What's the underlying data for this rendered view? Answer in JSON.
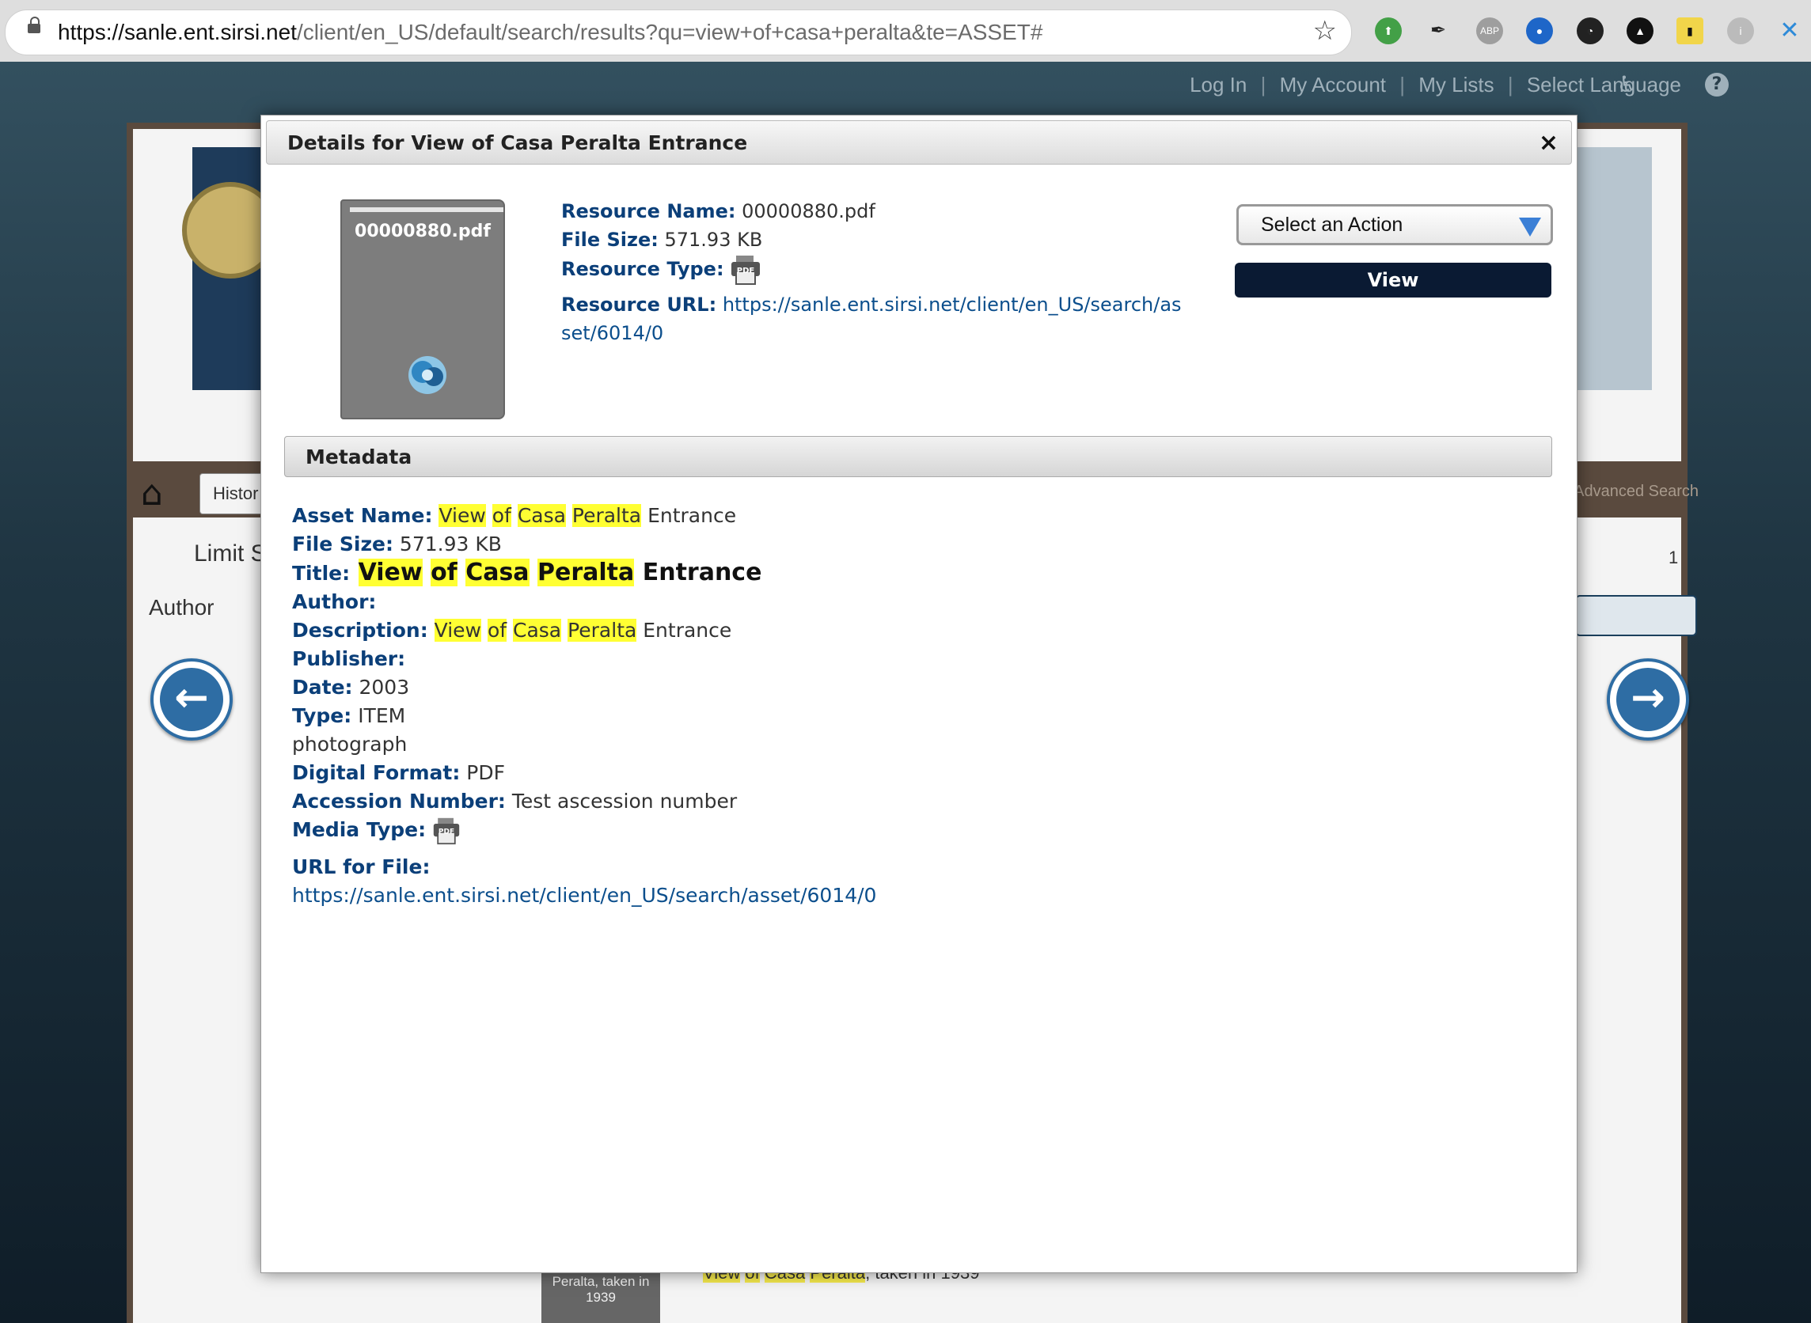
{
  "browser": {
    "url_host": "https://sanle.ent.sirsi.net",
    "url_path": "/client/en_US/default/search/results?qu=view+of+casa+peralta&te=ASSET#",
    "extensions": [
      "ABP"
    ]
  },
  "header_links": {
    "login": "Log In",
    "account": "My Account",
    "lists": "My Lists",
    "language": "Select Language",
    "sep": "|"
  },
  "background": {
    "history_tab": "Histor",
    "advanced_search": "Advanced Search",
    "limit_label": "Limit S",
    "author_label": "Author",
    "page_number": "1",
    "thumb_caption": "Peralta, taken in 1939",
    "peek_words": [
      "View",
      "of",
      "Casa",
      "Peralta"
    ],
    "peek_suffix": ", taken in 1939"
  },
  "modal": {
    "title": "Details for View of Casa Peralta Entrance",
    "close": "×",
    "thumbnail_filename": "00000880.pdf",
    "resource": {
      "name_label": "Resource Name:",
      "name_value": "00000880.pdf",
      "size_label": "File Size:",
      "size_value": "571.93 KB",
      "type_label": "Resource Type:",
      "url_label": "Resource URL:",
      "url_value_line1": "https://sanle.ent.sirsi.net/client/en_US/search/as",
      "url_value_line2": "set/6014/0"
    },
    "action_select": "Select an Action",
    "view_button": "View",
    "metadata_header": "Metadata",
    "metadata": {
      "asset_name_label": "Asset Name:",
      "file_size_label": "File Size:",
      "file_size_value": "571.93 KB",
      "title_label": "Title:",
      "highlight_words": [
        "View",
        "of",
        "Casa",
        "Peralta"
      ],
      "title_suffix": "Entrance",
      "author_label": "Author:",
      "description_label": "Description:",
      "publisher_label": "Publisher:",
      "date_label": "Date:",
      "date_value": "2003",
      "type_label": "Type:",
      "type_value": "ITEM",
      "type_value2": "photograph",
      "digital_format_label": "Digital Format:",
      "digital_format_value": "PDF",
      "accession_label": "Accession Number:",
      "accession_value": "Test ascession number",
      "media_type_label": "Media Type:",
      "url_for_file_label": "URL for File:",
      "url_for_file_value": "https://sanle.ent.sirsi.net/client/en_US/search/asset/6014/0"
    },
    "pdf_icon_text": "PDF"
  },
  "colors": {
    "label_blue": "#0b3f79",
    "highlight": "#ffff33",
    "view_button": "#0a1a33"
  }
}
